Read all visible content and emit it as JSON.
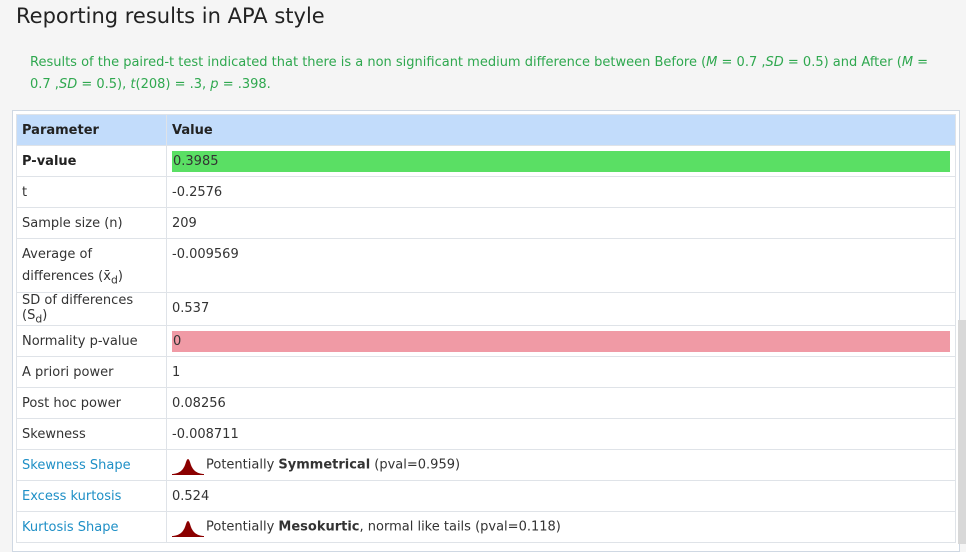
{
  "title": "Reporting results in APA style",
  "summary": {
    "text_a": "Results of the paired-t test indicated that there is a non significant medium difference between Before (",
    "m1_label": "M",
    "m1_value": " = 0.7 ,",
    "sd1_label": "SD",
    "sd1_value": " = 0.5) and After (",
    "m2_label": "M",
    "m2_value": " = 0.7 ,",
    "sd2_label": "SD",
    "sd2_value": " = 0.5), ",
    "t_label": "t",
    "t_value": "(208) = .3, ",
    "p_label": "p",
    "p_value": " = .398."
  },
  "table": {
    "headers": {
      "param": "Parameter",
      "value": "Value"
    },
    "rows": {
      "pvalue": {
        "param": "P-value",
        "value": "0.3985"
      },
      "t": {
        "param": "t",
        "value": "-0.2576"
      },
      "n": {
        "param": "Sample size (n)",
        "value": "209"
      },
      "avg": {
        "param_a": "Average of",
        "param_b": "differences (x̄",
        "param_sub": "d",
        "param_c": ")",
        "value": "-0.009569"
      },
      "sd": {
        "param_a": "SD of differences (S",
        "param_sub": "d",
        "param_c": ")",
        "value": "0.537"
      },
      "normality": {
        "param": "Normality p-value",
        "value": "0"
      },
      "apriori": {
        "param": "A priori power",
        "value": "1"
      },
      "posthoc": {
        "param": "Post hoc power",
        "value": "0.08256"
      },
      "skewness": {
        "param": "Skewness",
        "value": "-0.008711"
      },
      "skew_shape": {
        "param": "Skewness Shape",
        "prefix": "Potentially ",
        "bold": "Symmetrical",
        "suffix": " (pval=0.959)"
      },
      "kurtosis": {
        "param": "Excess kurtosis",
        "value": "0.524"
      },
      "kurt_shape": {
        "param": "Kurtosis Shape",
        "prefix": "Potentially ",
        "bold": "Mesokurtic",
        "suffix": ", normal like tails (pval=0.118)"
      }
    }
  },
  "colors": {
    "green_bar": "#5adf64",
    "red_bar": "#f09aa5",
    "header_bg": "#c2dcfb",
    "summary_text": "#2fa84f",
    "link": "#1e8fc6",
    "icon": "#8b0000"
  },
  "icons": [
    "distribution-curve-icon"
  ]
}
